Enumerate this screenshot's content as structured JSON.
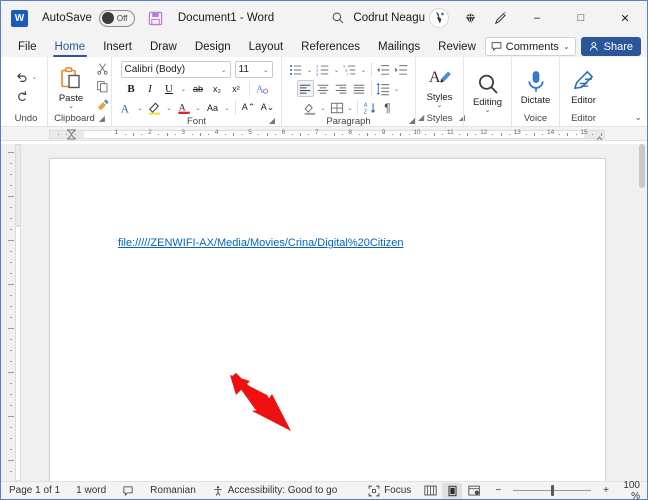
{
  "titlebar": {
    "app_icon": "word-logo-icon",
    "autosave_label": "AutoSave",
    "autosave_state": "Off",
    "save_icon": "save-icon",
    "document_title": "Document1  -  Word",
    "search_icon": "search-icon",
    "user_name": "Codrut Neagu",
    "avatar_icon": "user-avatar-icon",
    "diamond_icon": "diamond-icon",
    "pen_icon": "pen-icon",
    "minimize": "–",
    "maximize": "□",
    "close": "✕"
  },
  "tabs": [
    {
      "label": "File",
      "active": false
    },
    {
      "label": "Home",
      "active": true
    },
    {
      "label": "Insert",
      "active": false
    },
    {
      "label": "Draw",
      "active": false
    },
    {
      "label": "Design",
      "active": false
    },
    {
      "label": "Layout",
      "active": false
    },
    {
      "label": "References",
      "active": false
    },
    {
      "label": "Mailings",
      "active": false
    },
    {
      "label": "Review",
      "active": false
    },
    {
      "label": "View",
      "active": false
    },
    {
      "label": "Help",
      "active": false
    }
  ],
  "tabrow_right": {
    "comments_label": "Comments",
    "comments_chevron": "⌄",
    "share_label": "Share"
  },
  "ribbon": {
    "collapse_chevron": "⌄",
    "groups": [
      {
        "name": "Undo",
        "label": "Undo",
        "dialog_launcher": false,
        "items": [
          {
            "name": "undo-button",
            "glyph": "↶"
          },
          {
            "name": "undo-dropdown",
            "glyph": "⌄"
          },
          {
            "name": "redo-button",
            "glyph": "↻"
          }
        ]
      },
      {
        "name": "Clipboard",
        "label": "Clipboard",
        "dialog_launcher": true,
        "items": [
          {
            "name": "paste-button",
            "label": "Paste"
          },
          {
            "name": "cut-button",
            "glyph": "✂"
          },
          {
            "name": "copy-button",
            "glyph": "⧉"
          },
          {
            "name": "format-painter-button",
            "glyph": "✒"
          }
        ]
      },
      {
        "name": "Font",
        "label": "Font",
        "dialog_launcher": true,
        "font_name": "Calibri (Body)",
        "font_size": "11",
        "items": [
          {
            "name": "bold-button",
            "label": "B"
          },
          {
            "name": "italic-button",
            "label": "I"
          },
          {
            "name": "underline-button",
            "label": "U"
          },
          {
            "name": "underline-dropdown",
            "label": "⌄"
          },
          {
            "name": "strikethrough-button",
            "label": "ab"
          },
          {
            "name": "subscript-button",
            "label": "x₂"
          },
          {
            "name": "superscript-button",
            "label": "x²"
          },
          {
            "name": "text-effects-button",
            "label": "A"
          },
          {
            "name": "text-highlight-color-button",
            "label": "A"
          },
          {
            "name": "font-color-button",
            "label": "A"
          },
          {
            "name": "change-case-button",
            "label": "Aa"
          },
          {
            "name": "grow-font-button",
            "label": "A⌃"
          },
          {
            "name": "shrink-font-button",
            "label": "A⌄"
          }
        ]
      },
      {
        "name": "Paragraph",
        "label": "Paragraph",
        "dialog_launcher": true,
        "items": [
          {
            "name": "bullets-button"
          },
          {
            "name": "numbering-button"
          },
          {
            "name": "multilevel-list-button"
          },
          {
            "name": "decrease-indent-button"
          },
          {
            "name": "increase-indent-button"
          },
          {
            "name": "align-left-button"
          },
          {
            "name": "align-center-button"
          },
          {
            "name": "align-right-button"
          },
          {
            "name": "justify-button"
          },
          {
            "name": "line-spacing-button"
          },
          {
            "name": "shading-button"
          },
          {
            "name": "borders-button"
          },
          {
            "name": "sort-button"
          },
          {
            "name": "show-formatting-marks-button"
          }
        ]
      },
      {
        "name": "Styles",
        "label": "Styles",
        "dialog_launcher": true,
        "items": [
          {
            "name": "styles-button",
            "label": "Styles"
          }
        ]
      },
      {
        "name": "Editing",
        "label": "",
        "dialog_launcher": false,
        "items": [
          {
            "name": "editing-button",
            "label": "Editing"
          }
        ]
      },
      {
        "name": "Voice",
        "label": "Voice",
        "dialog_launcher": false,
        "items": [
          {
            "name": "dictate-button",
            "label": "Dictate"
          }
        ]
      },
      {
        "name": "Editor",
        "label": "Editor",
        "dialog_launcher": false,
        "items": [
          {
            "name": "editor-button",
            "label": "Editor"
          }
        ]
      }
    ]
  },
  "ruler": {
    "ticks": [
      "1",
      "2",
      "3",
      "4",
      "5",
      "6",
      "7",
      "8",
      "9",
      "10",
      "11",
      "12",
      "13",
      "14",
      "15"
    ]
  },
  "document": {
    "hyperlink_text": "file://///ZENWIFI-AX/Media/Movies/Crina/Digital%20Citizen",
    "hyperlink_color": "#0563c1",
    "annotation_arrow_color": "#ee1111"
  },
  "status": {
    "page_info": "Page 1 of 1",
    "word_count": "1 word",
    "proofing_icon": "proofing-icon",
    "language": "Romanian",
    "accessibility": "Accessibility: Good to go",
    "focus_label": "Focus",
    "view_read_icon": "read-mode-icon",
    "view_print_icon": "print-layout-icon",
    "view_web_icon": "web-layout-icon",
    "zoom_minus": "−",
    "zoom_plus": "+",
    "zoom_level": "100 %"
  }
}
